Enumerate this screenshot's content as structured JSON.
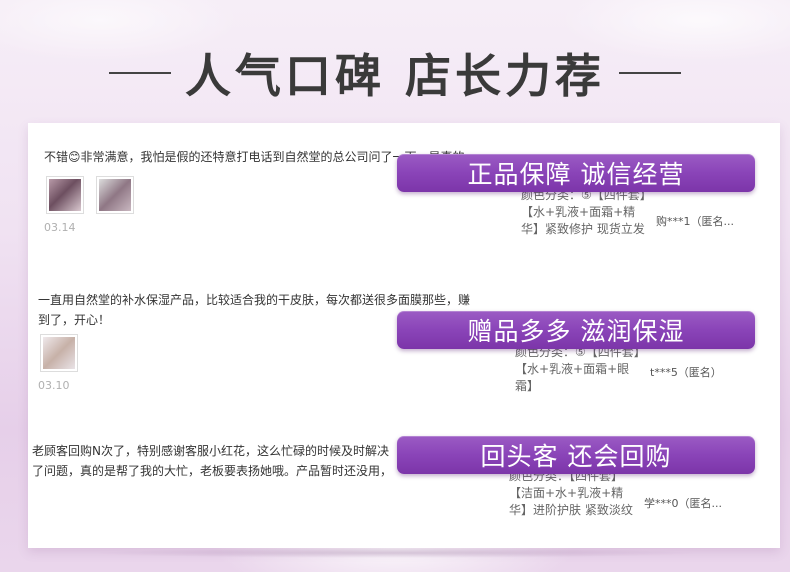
{
  "header": {
    "title": "人气口碑 店长力荐"
  },
  "reviews": [
    {
      "text": "不错😊非常满意，我怕是假的还特意打电话到自然堂的总公司问了一下，是真的",
      "date": "03.14",
      "spec": "颜色分类：⑤【四件套】【水+乳液+面霜+精华】紧致修护 现货立发",
      "user": "购***1（匿名..."
    },
    {
      "text": "一直用自然堂的补水保湿产品，比较适合我的干皮肤，每次都送很多面膜那些，赚到了，开心！",
      "date": "03.10",
      "spec": "颜色分类：⑤【四件套】【水+乳液+面霜+眼霜】",
      "user": "t***5（匿名）"
    },
    {
      "text": "老顾客回购N次了，特别感谢客服小红花，这么忙碌的时候及时解决了问题，真的是帮了我的大忙，老板要表扬她哦。产品暂时还没用，就是发现送的东西",
      "spec": "颜色分类：【四件套】【洁面+水+乳液+精华】进阶护肤 紧致淡纹",
      "user": "学***0（匿名..."
    }
  ],
  "banners": [
    "正品保障 诚信经营",
    "赠品多多 滋润保湿",
    "回头客 还会回购"
  ]
}
